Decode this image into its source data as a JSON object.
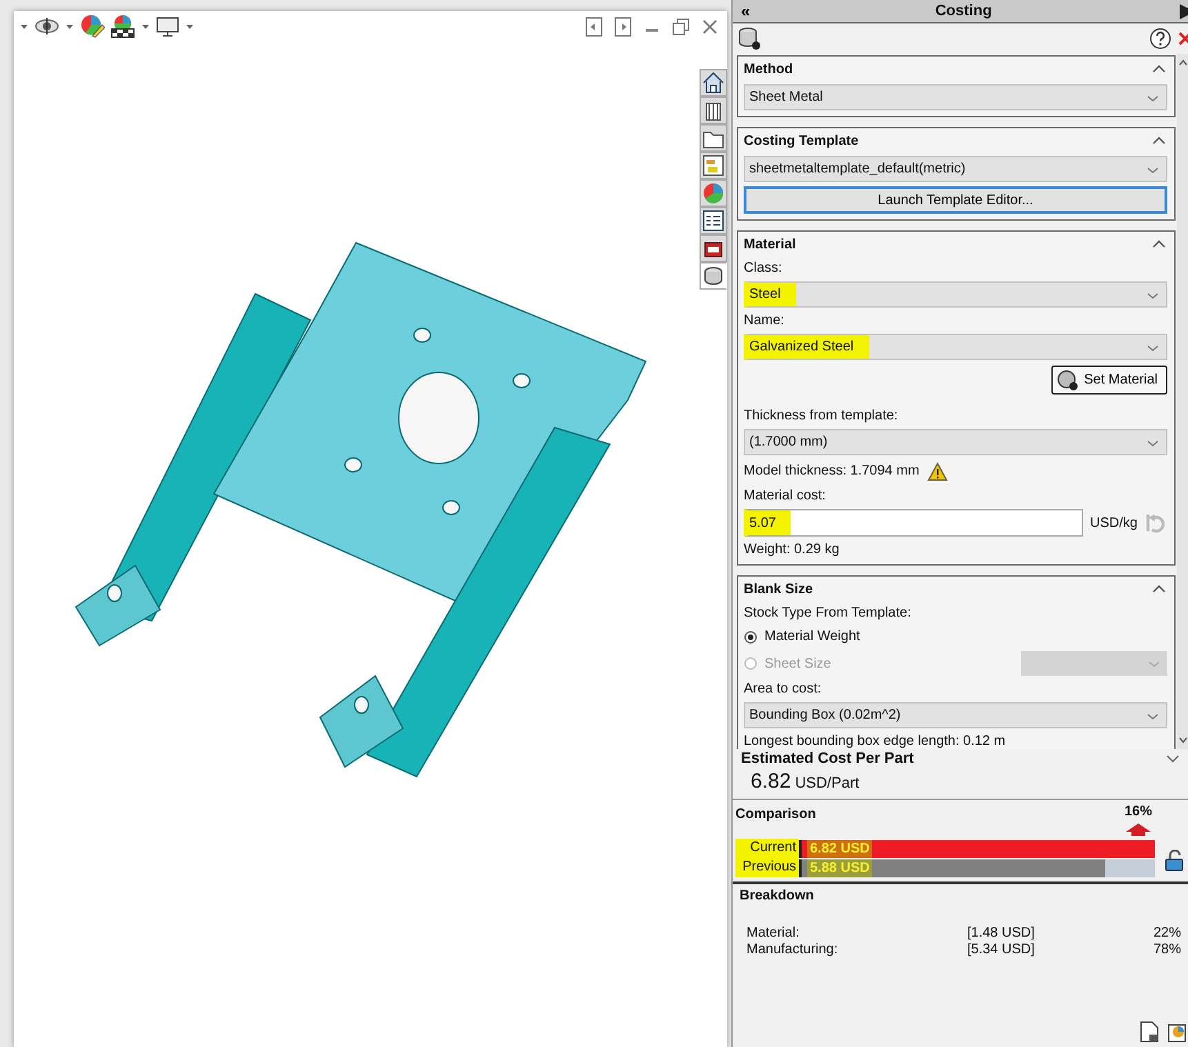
{
  "side_tabs": [
    {
      "kind": "home",
      "selected": false
    },
    {
      "kind": "parts",
      "selected": false
    },
    {
      "kind": "folder",
      "selected": false
    },
    {
      "kind": "display",
      "selected": false
    },
    {
      "kind": "appearance",
      "selected": false
    },
    {
      "kind": "properties",
      "selected": false
    },
    {
      "kind": "toolbox",
      "selected": false
    },
    {
      "kind": "costing",
      "selected": true
    }
  ],
  "panel": {
    "title": "Costing",
    "collapse": "«"
  },
  "sections": [
    {
      "title": "Method",
      "items": [
        {
          "kind": "select",
          "value": "Sheet Metal",
          "highlighted": false
        }
      ]
    },
    {
      "title": "Costing Template",
      "items": [
        {
          "kind": "select",
          "value": "sheetmetaltemplate_default(metric)",
          "highlighted": false
        },
        {
          "kind": "wide-button",
          "label": "Launch Template Editor..."
        }
      ]
    },
    {
      "title": "Material",
      "items": [
        {
          "kind": "label",
          "text": "Class:"
        },
        {
          "kind": "select",
          "value": "Steel",
          "highlighted": true
        },
        {
          "kind": "label",
          "text": "Name:"
        },
        {
          "kind": "select",
          "value": "Galvanized Steel",
          "highlighted": true
        },
        {
          "kind": "icon-button",
          "label": "Set Material"
        },
        {
          "kind": "label",
          "text": "Thickness from template:"
        },
        {
          "kind": "select",
          "value": "(1.7000 mm)",
          "highlighted": false
        },
        {
          "kind": "warning",
          "text": "Model thickness: 1.7094 mm"
        },
        {
          "kind": "label",
          "text": "Material cost:"
        },
        {
          "kind": "input",
          "value": "5.07",
          "unit": "USD/kg",
          "highlighted": true
        },
        {
          "kind": "label",
          "text": "Weight: 0.29 kg"
        }
      ]
    },
    {
      "title": "Blank Size",
      "items": [
        {
          "kind": "label",
          "text": "Stock Type From Template:"
        },
        {
          "kind": "radio",
          "label": "Material Weight",
          "selected": true,
          "disabled": false
        },
        {
          "kind": "radio",
          "label": "Sheet Size",
          "selected": false,
          "disabled": true
        },
        {
          "kind": "label",
          "text": "Area to cost:"
        },
        {
          "kind": "select",
          "value": "Bounding Box (0.02m^2)",
          "highlighted": false
        },
        {
          "kind": "label",
          "text": "Longest bounding box edge length: 0.12 m"
        }
      ]
    }
  ],
  "estimate": {
    "title": "Estimated Cost Per Part",
    "value": "6.82",
    "unit": "USD/Part"
  },
  "comparison": {
    "title": "Comparison",
    "change": "16%",
    "bars": [
      {
        "label": "Current",
        "value": "6.82 USD",
        "level": 1,
        "color": "#ee1c25",
        "highlighted": true
      },
      {
        "label": "Previous",
        "value": "5.88 USD",
        "level": 0.86,
        "color": "#808080",
        "highlighted": true
      }
    ]
  },
  "breakdown": {
    "title": "Breakdown",
    "rows": [
      {
        "name": "Material:",
        "cost": "[1.48 USD]",
        "share": "22%"
      },
      {
        "name": "Manufacturing:",
        "cost": "[5.34 USD]",
        "share": "78%"
      }
    ]
  }
}
